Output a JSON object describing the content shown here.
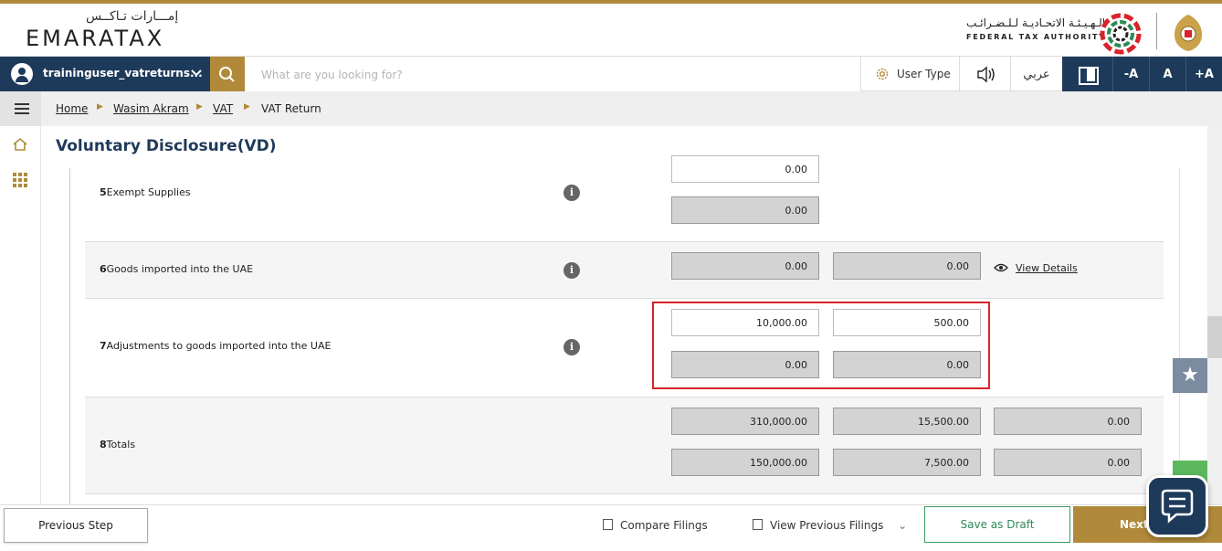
{
  "brand": {
    "logo_arabic": "إمـــارات تـاكــس",
    "logo_text": "EMARATAX",
    "authority_arabic": "الـهـيـئـة الاتحـاديـة لـلـضـرائـب",
    "authority_english": "FEDERAL TAX AUTHORITY"
  },
  "nav": {
    "user_name": "traininguser_vatreturns...",
    "search_placeholder": "What are you looking for?",
    "user_type_label": "User Type",
    "language_label": "عربي",
    "font_decrease": "-A",
    "font_normal": "A",
    "font_increase": "+A"
  },
  "breadcrumb": {
    "home": "Home",
    "account": "Wasim Akram",
    "vat": "VAT",
    "current": "VAT Return"
  },
  "page": {
    "title": "Voluntary Disclosure(VD)"
  },
  "rows": {
    "r5": {
      "num": "5",
      "label": "Exempt Supplies",
      "top_value": "0.00",
      "bottom_value": "0.00"
    },
    "r6": {
      "num": "6",
      "label": "Goods imported into the UAE",
      "amount": "0.00",
      "vat": "0.00",
      "view_details": "View Details"
    },
    "r7": {
      "num": "7",
      "label": "Adjustments to goods imported into the UAE",
      "amount": "10,000.00",
      "vat": "500.00",
      "orig_amount": "0.00",
      "orig_vat": "0.00"
    },
    "r8": {
      "num": "8",
      "label": "Totals",
      "amount": "310,000.00",
      "vat": "15,500.00",
      "adj": "0.00",
      "orig_amount": "150,000.00",
      "orig_vat": "7,500.00",
      "orig_adj": "0.00"
    }
  },
  "info_glyph": "i",
  "star_glyph": "★",
  "footer": {
    "previous_step": "Previous Step",
    "compare_filings": "Compare Filings",
    "view_previous_filings": "View Previous Filings",
    "dropdown_glyph": "⌄",
    "save_as_draft": "Save as Draft",
    "next": "Next"
  },
  "colors": {
    "navy": "#1e3a5a",
    "gold": "#b08a3a",
    "highlight_red": "#d8232a",
    "draft_green": "#2e8b57"
  },
  "icons": [
    "user-avatar-icon",
    "chevron-down-icon",
    "search-icon",
    "gear-icon",
    "speaker-icon",
    "contrast-icon",
    "hamburger-icon",
    "home-icon",
    "grid-icon",
    "info-icon",
    "eye-icon",
    "star-icon",
    "chat-icon",
    "copy-icon",
    "history-icon"
  ]
}
